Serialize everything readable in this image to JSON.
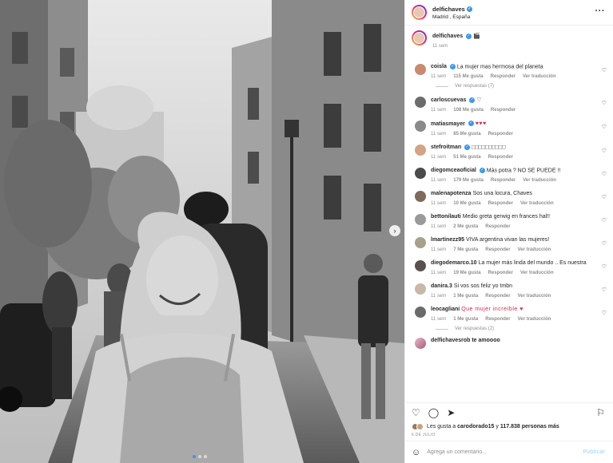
{
  "post": {
    "username": "delfichaves",
    "location": "Madrid , España",
    "caption_emoji": "🎬",
    "caption_time": "11 sem",
    "more_icon": "more-horizontal-icon"
  },
  "labels": {
    "like": "Me gusta",
    "reply": "Responder",
    "translate": "Ver traducción",
    "view_replies_1": "Ver respuestas (7)",
    "view_replies_2": "Ver respuestas (2)"
  },
  "comments": [
    {
      "user": "coisla",
      "verified": true,
      "text": "La mujer mas hermosa del planeta",
      "time": "11 sem",
      "likes": "115 Me gusta",
      "translate": true
    },
    {
      "user": "carloscuevas",
      "verified": true,
      "text": "♡",
      "time": "11 sem",
      "likes": "108 Me gusta",
      "translate": false
    },
    {
      "user": "matiasmayer",
      "verified": true,
      "text": "♥♥♥",
      "time": "11 sem",
      "likes": "85 Me gusta",
      "translate": false
    },
    {
      "user": "stefroitman",
      "verified": true,
      "text": "□□□□□□□□□□",
      "time": "11 sem",
      "likes": "51 Me gusta",
      "translate": false
    },
    {
      "user": "diegomceaoficial",
      "verified": true,
      "text": "Más potra ? NO SE PUEDE !!",
      "time": "11 sem",
      "likes": "179 Me gusta",
      "translate": true
    },
    {
      "user": "malenapotenza",
      "verified": false,
      "text": "Sos una locura, Chaves",
      "time": "11 sem",
      "likes": "10 Me gusta",
      "translate": true
    },
    {
      "user": "bettonilauti",
      "verified": false,
      "text": "Medio greta gerwig en frances hal!!",
      "time": "11 sem",
      "likes": "2 Me gusta",
      "translate": false
    },
    {
      "user": "lmartinezz95",
      "verified": false,
      "text": "VIVA argentina vivan las mujeres!",
      "time": "11 sem",
      "likes": "7 Me gusta",
      "translate": true
    },
    {
      "user": "diegodemarco.10",
      "verified": false,
      "text": "La mujer más linda del mundo .. Es nuestra",
      "time": "11 sem",
      "likes": "19 Me gusta",
      "translate": true
    },
    {
      "user": "danira.3",
      "verified": false,
      "text": "Si vos sos feliz yo tmbn",
      "time": "11 sem",
      "likes": "1 Me gusta",
      "translate": true
    },
    {
      "user": "leocagliani",
      "verified": false,
      "text": "Que mujer increíble ♥",
      "time": "11 sem",
      "likes": "1 Me gusta",
      "translate": true
    }
  ],
  "partial_comment": "delfichavesrob te amoooo",
  "footer": {
    "likes_prefix": "Les gusta a",
    "likes_user": "carodorado15",
    "likes_mid": "y",
    "likes_count": "117.838 personas más",
    "date": "6 DE JULIO",
    "comment_placeholder": "Agrega un comentario...",
    "publish": "Publicar"
  },
  "icons": {
    "like": "heart-icon",
    "comment": "comment-icon",
    "share": "share-icon",
    "save": "bookmark-icon",
    "emoji": "smiley-icon",
    "next": "chevron-right-icon"
  },
  "colors": {
    "accent": "#3897f0",
    "text": "#262626",
    "muted": "#8e8e8e",
    "heart": "#d6264a"
  }
}
